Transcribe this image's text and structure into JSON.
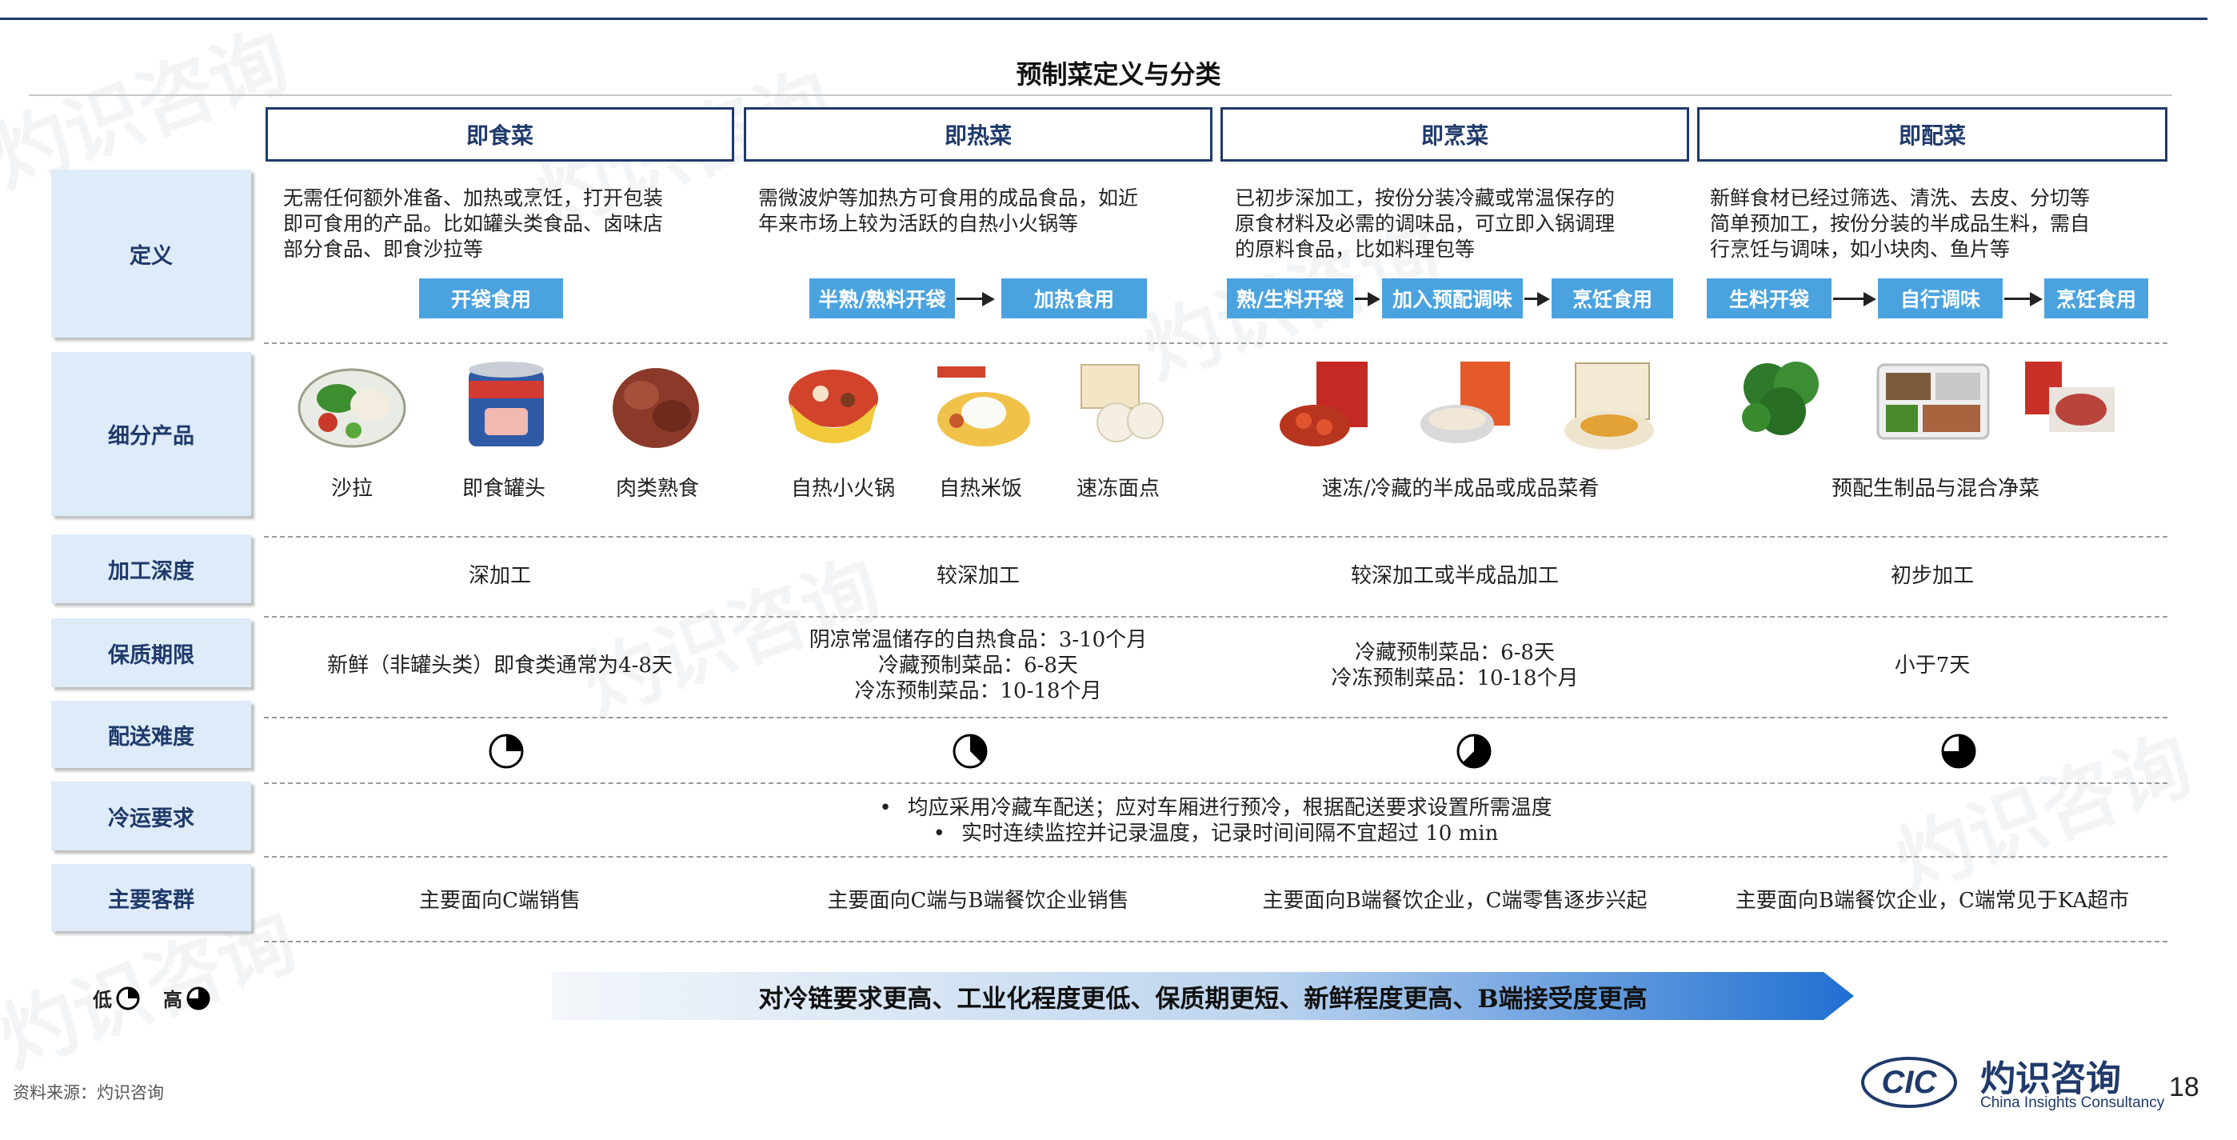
{
  "title": "预制菜定义与分类",
  "categories": [
    "即食菜",
    "即热菜",
    "即烹菜",
    "即配菜"
  ],
  "row_labels": [
    "定义",
    "细分产品",
    "加工深度",
    "保质期限",
    "配送难度",
    "冷运要求",
    "主要客群"
  ],
  "definitions": [
    {
      "lines": [
        "无需任何额外准备、加热或烹饪，打开包装",
        "即可食用的产品。比如罐头类食品、卤味店",
        "部分食品、即食沙拉等"
      ],
      "steps": [
        "开袋食用"
      ]
    },
    {
      "lines": [
        "需微波炉等加热方可食用的成品食品，如近",
        "年来市场上较为活跃的自热小火锅等"
      ],
      "steps": [
        "半熟/熟料开袋",
        "加热食用"
      ]
    },
    {
      "lines": [
        "已初步深加工，按份分装冷藏或常温保存的",
        "原食材料及必需的调味品，可立即入锅调理",
        "的原料食品，比如料理包等"
      ],
      "steps": [
        "熟/生料开袋",
        "加入预配调味",
        "烹饪食用"
      ]
    },
    {
      "lines": [
        "新鲜食材已经过筛选、清洗、去皮、分切等",
        "简单预加工，按份分装的半成品生料，需自",
        "行烹饪与调味，如小块肉、鱼片等"
      ],
      "steps": [
        "生料开袋",
        "自行调味",
        "烹饪食用"
      ]
    }
  ],
  "products": {
    "items": [
      "沙拉",
      "即食罐头",
      "肉类熟食",
      "自热小火锅",
      "自热米饭",
      "速冻面点"
    ],
    "group3": "速冻/冷藏的半成品或成品菜肴",
    "group4": "预配生制品与混合净菜"
  },
  "processing": [
    "深加工",
    "较深加工",
    "较深加工或半成品加工",
    "初步加工"
  ],
  "shelf_life": [
    [
      "新鲜（非罐头类）即食类通常为4-8天"
    ],
    [
      "阴凉常温储存的自热食品：3-10个月",
      "冷藏预制菜品：6-8天",
      "冷冻预制菜品：10-18个月"
    ],
    [
      "冷藏预制菜品：6-8天",
      "冷冻预制菜品：10-18个月"
    ],
    [
      "小于7天"
    ]
  ],
  "delivery_difficulty": [
    0.25,
    0.375,
    0.625,
    0.75
  ],
  "cold_chain": [
    "均应采用冷藏车配送；应对车厢进行预冷，根据配送要求设置所需温度",
    "实时连续监控并记录温度，记录时间间隔不宜超过 10 min"
  ],
  "customers": [
    "主要面向C端销售",
    "主要面向C端与B端餐饮企业销售",
    "主要面向B端餐饮企业，C端零售逐步兴起",
    "主要面向B端餐饮企业，C端常见于KA超市"
  ],
  "legend": {
    "low": "低",
    "high": "高"
  },
  "banner": "对冷链要求更高、工业化程度更低、保质期更短、新鲜程度更高、B端接受度更高",
  "source": "资料来源：灼识咨询",
  "logo": {
    "mark": "CIC",
    "cn": "灼识咨询",
    "en": "China Insights Consultancy"
  },
  "watermark": "灼识咨询",
  "page_number": "18",
  "colors": {
    "navy": "#1f3a6b",
    "step_blue": "#4aa3df",
    "label_bg": "#deebf8"
  }
}
